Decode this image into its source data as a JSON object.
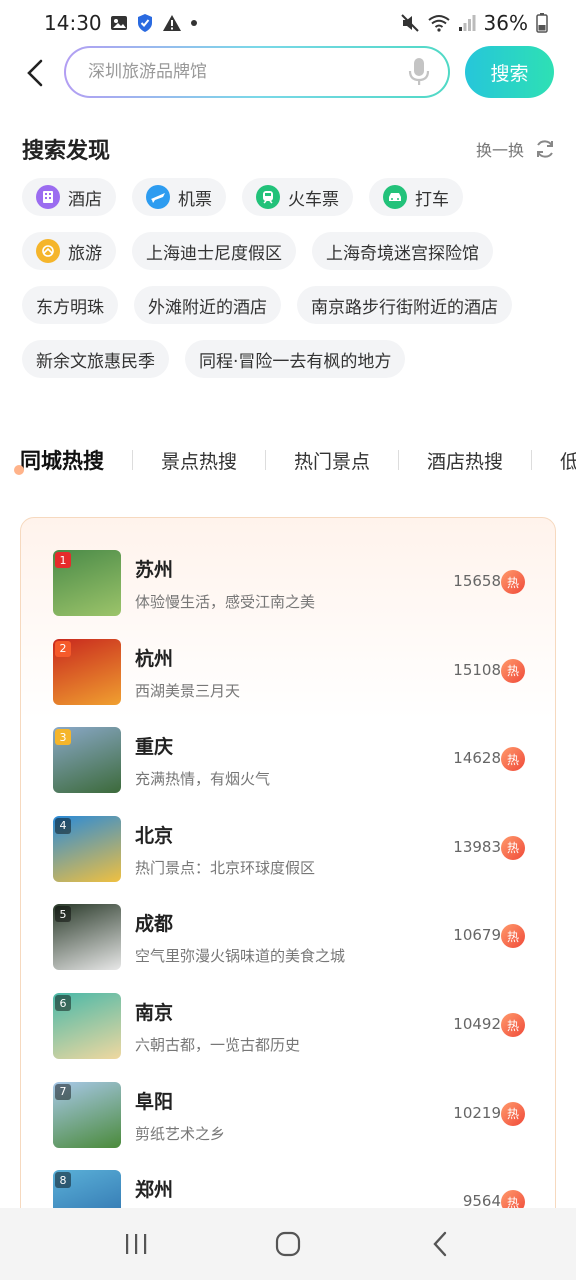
{
  "status_bar": {
    "time": "14:30",
    "battery": "36%"
  },
  "search": {
    "placeholder": "深圳旅游品牌馆",
    "button_label": "搜索"
  },
  "discover": {
    "title": "搜索发现",
    "refresh_label": "换一换",
    "chips": [
      {
        "label": "酒店",
        "icon": "hotel-icon",
        "color": "#9b6cf0"
      },
      {
        "label": "机票",
        "icon": "plane-icon",
        "color": "#2d9cf0"
      },
      {
        "label": "火车票",
        "icon": "train-icon",
        "color": "#22c27a"
      },
      {
        "label": "打车",
        "icon": "car-icon",
        "color": "#22c27a"
      },
      {
        "label": "旅游",
        "icon": "travel-icon",
        "color": "#f5b52b"
      },
      {
        "label": "上海迪士尼度假区"
      },
      {
        "label": "上海奇境迷宫探险馆"
      },
      {
        "label": "东方明珠"
      },
      {
        "label": "外滩附近的酒店"
      },
      {
        "label": "南京路步行街附近的酒店"
      },
      {
        "label": "新余文旅惠民季"
      },
      {
        "label": "同程·冒险一去有枫的地方"
      }
    ]
  },
  "tabs": [
    {
      "label": "同城热搜",
      "active": true
    },
    {
      "label": "景点热搜"
    },
    {
      "label": "热门景点"
    },
    {
      "label": "酒店热搜"
    },
    {
      "label": "低价"
    }
  ],
  "hot_list": [
    {
      "rank": "1",
      "name": "苏州",
      "desc": "体验慢生活，感受江南之美",
      "heat": "15658",
      "badge": "热",
      "thumb_colors": [
        "#4a8a48",
        "#9cc46a"
      ]
    },
    {
      "rank": "2",
      "name": "杭州",
      "desc": "西湖美景三月天",
      "heat": "15108",
      "badge": "热",
      "thumb_colors": [
        "#c8281e",
        "#f0a030"
      ]
    },
    {
      "rank": "3",
      "name": "重庆",
      "desc": "充满热情，有烟火气",
      "heat": "14628",
      "badge": "热",
      "thumb_colors": [
        "#8aa8c8",
        "#3c6a3a"
      ]
    },
    {
      "rank": "4",
      "name": "北京",
      "desc": "热门景点：北京环球度假区",
      "heat": "13983",
      "badge": "热",
      "thumb_colors": [
        "#2a8ad8",
        "#f0c040"
      ]
    },
    {
      "rank": "5",
      "name": "成都",
      "desc": "空气里弥漫火锅味道的美食之城",
      "heat": "10679",
      "badge": "热",
      "thumb_colors": [
        "#2a3a2a",
        "#e8e8e8"
      ]
    },
    {
      "rank": "6",
      "name": "南京",
      "desc": "六朝古都，一览古都历史",
      "heat": "10492",
      "badge": "热",
      "thumb_colors": [
        "#4ab8a8",
        "#f0d8a0"
      ]
    },
    {
      "rank": "7",
      "name": "阜阳",
      "desc": "剪纸艺术之乡",
      "heat": "10219",
      "badge": "热",
      "thumb_colors": [
        "#a8c8e8",
        "#4a8a3a"
      ]
    },
    {
      "rank": "8",
      "name": "郑州",
      "desc": "",
      "heat": "9564",
      "badge": "热",
      "thumb_colors": [
        "#5ab0d8",
        "#2a6aa8"
      ]
    }
  ]
}
